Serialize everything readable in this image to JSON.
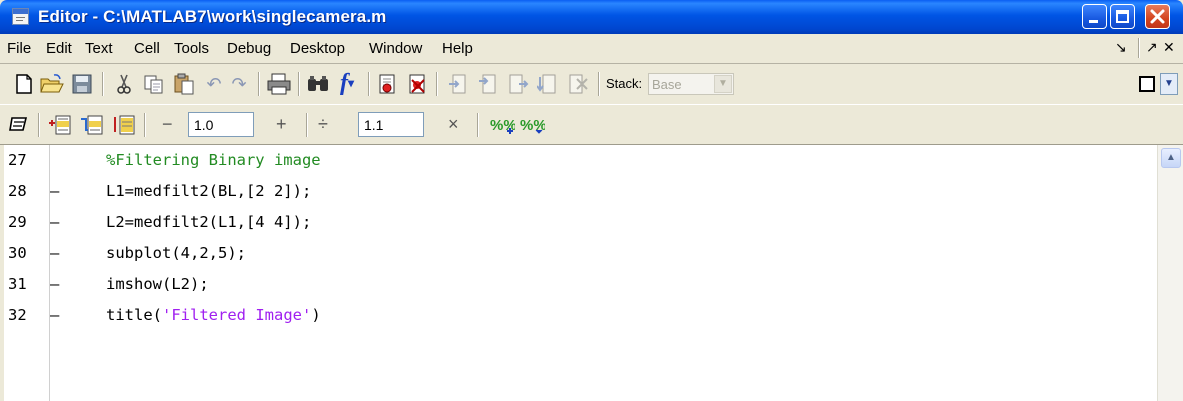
{
  "window": {
    "title": "Editor - C:\\MATLAB7\\work\\singlecamera.m"
  },
  "menubar": {
    "items": [
      "File",
      "Edit",
      "Text",
      "Cell",
      "Tools",
      "Debug",
      "Desktop",
      "Window",
      "Help"
    ],
    "undock_glyph": "↘",
    "undock2_glyph": "↗",
    "close_glyph": "✕"
  },
  "toolbar": {
    "stack_label": "Stack:",
    "stack_value": "Base"
  },
  "cell_toolbar": {
    "decrement_glyph": "−",
    "increment_glyph": "+",
    "increment_value": "1.0",
    "divide_glyph": "÷",
    "multiply_glyph": "×",
    "scale_value": "1.1"
  },
  "editor": {
    "lines": [
      {
        "number": "27",
        "marker": "",
        "code": "%Filtering Binary image",
        "kind": "comment"
      },
      {
        "number": "28",
        "marker": "–",
        "code": "L1=medfilt2(BL,[2 2]);",
        "kind": "code"
      },
      {
        "number": "29",
        "marker": "–",
        "code": "L2=medfilt2(L1,[4 4]);",
        "kind": "code"
      },
      {
        "number": "30",
        "marker": "–",
        "code": "subplot(4,2,5);",
        "kind": "code"
      },
      {
        "number": "31",
        "marker": "–",
        "code": "imshow(L2);",
        "kind": "code"
      },
      {
        "number": "32",
        "marker": "–",
        "code_prefix": "title(",
        "code_string": "'Filtered Image'",
        "code_suffix": ")",
        "kind": "mixed"
      }
    ]
  },
  "colors": {
    "title_bar": "#0055e5",
    "comment": "#228b22",
    "string": "#a020f0",
    "chrome": "#ece9d8"
  }
}
